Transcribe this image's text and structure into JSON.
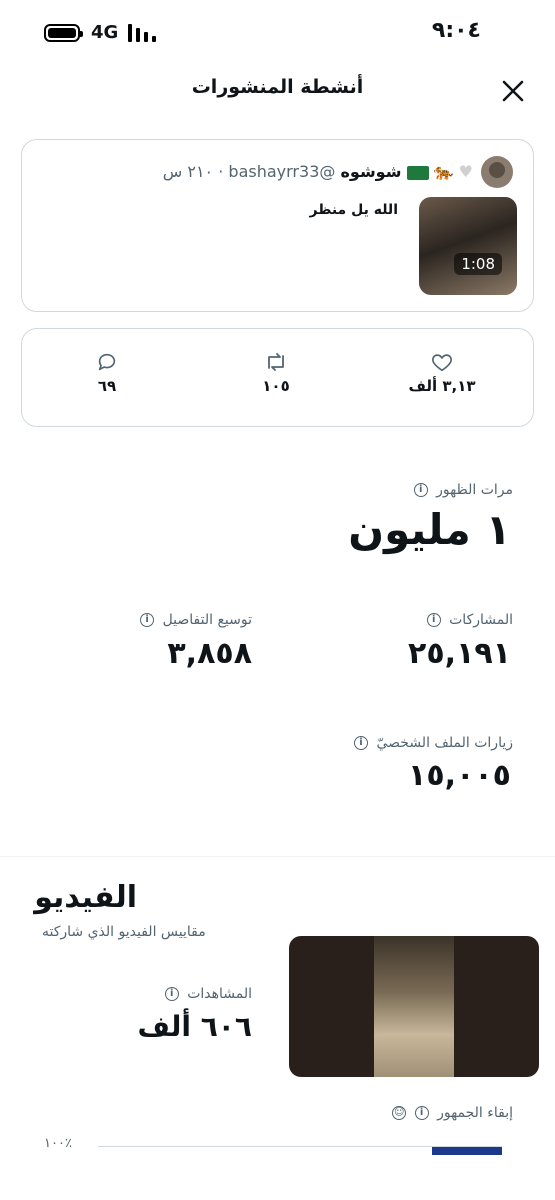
{
  "status_bar": {
    "time": "٩:٠٤",
    "network": "4G"
  },
  "header": {
    "title": "أنشطة المنشورات"
  },
  "tweet": {
    "name": "شوشوه",
    "handle": "@bashayrr33",
    "time": "٢١٠ س",
    "text": "الله يل منظر",
    "video_duration": "1:08"
  },
  "engagement": {
    "likes": "٣,١٣ ألف",
    "retweets": "١٠٥",
    "replies": "٦٩"
  },
  "metrics": {
    "impressions": {
      "label": "مرات الظهور",
      "value": "١ مليون"
    },
    "engagements": {
      "label": "المشاركات",
      "value": "٢٥,١٩١"
    },
    "detail_expands": {
      "label": "توسيع التفاصيل",
      "value": "٣,٨٥٨"
    },
    "profile_visits": {
      "label": "زيارات الملف الشخصيّ",
      "value": "١٥,٠٠٥"
    }
  },
  "video": {
    "title": "الفيديو",
    "subtitle": "مقاييس الفيديو الذي شاركته",
    "views_label": "المشاهدات",
    "views_value": "٦٠٦ ألف",
    "retention_label": "إبقاء الجمهور",
    "retention_percent": "١٠٠٪"
  },
  "colors": {
    "accent": "#1d3a8a",
    "muted": "#536471",
    "border": "#cfd9de"
  }
}
